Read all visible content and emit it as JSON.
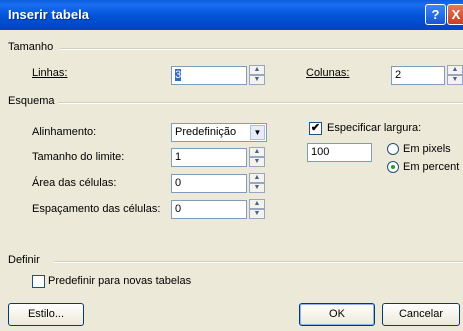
{
  "window": {
    "title": "Inserir tabela"
  },
  "titlebar_buttons": {
    "help": "?",
    "close": "X"
  },
  "tamanho": {
    "heading": "Tamanho",
    "linhas_label": "Linhas:",
    "linhas_value": "3",
    "colunas_label": "Colunas:",
    "colunas_value": "2"
  },
  "esquema": {
    "heading": "Esquema",
    "alinhamento_label": "Alinhamento:",
    "alinhamento_value": "Predefinição",
    "tamanho_limite_label": "Tamanho do limite:",
    "tamanho_limite_value": "1",
    "area_celulas_label": "Área das células:",
    "area_celulas_value": "0",
    "espacamento_label": "Espaçamento das células:",
    "espacamento_value": "0",
    "especificar_largura_label": "Especificar largura:",
    "especificar_largura_checked": true,
    "largura_value": "100",
    "em_pixels_label": "Em pixels",
    "em_percent_label": "Em percent",
    "selected_unit": "percent"
  },
  "definir": {
    "heading": "Definir",
    "predefinir_label": "Predefinir para novas tabelas",
    "predefinir_checked": false
  },
  "buttons": {
    "estilo": "Estilo...",
    "ok": "OK",
    "cancelar": "Cancelar"
  },
  "icons": {
    "check_mark": "✔",
    "spin_up": "▲",
    "spin_down": "▼",
    "dropdown": "▼"
  }
}
